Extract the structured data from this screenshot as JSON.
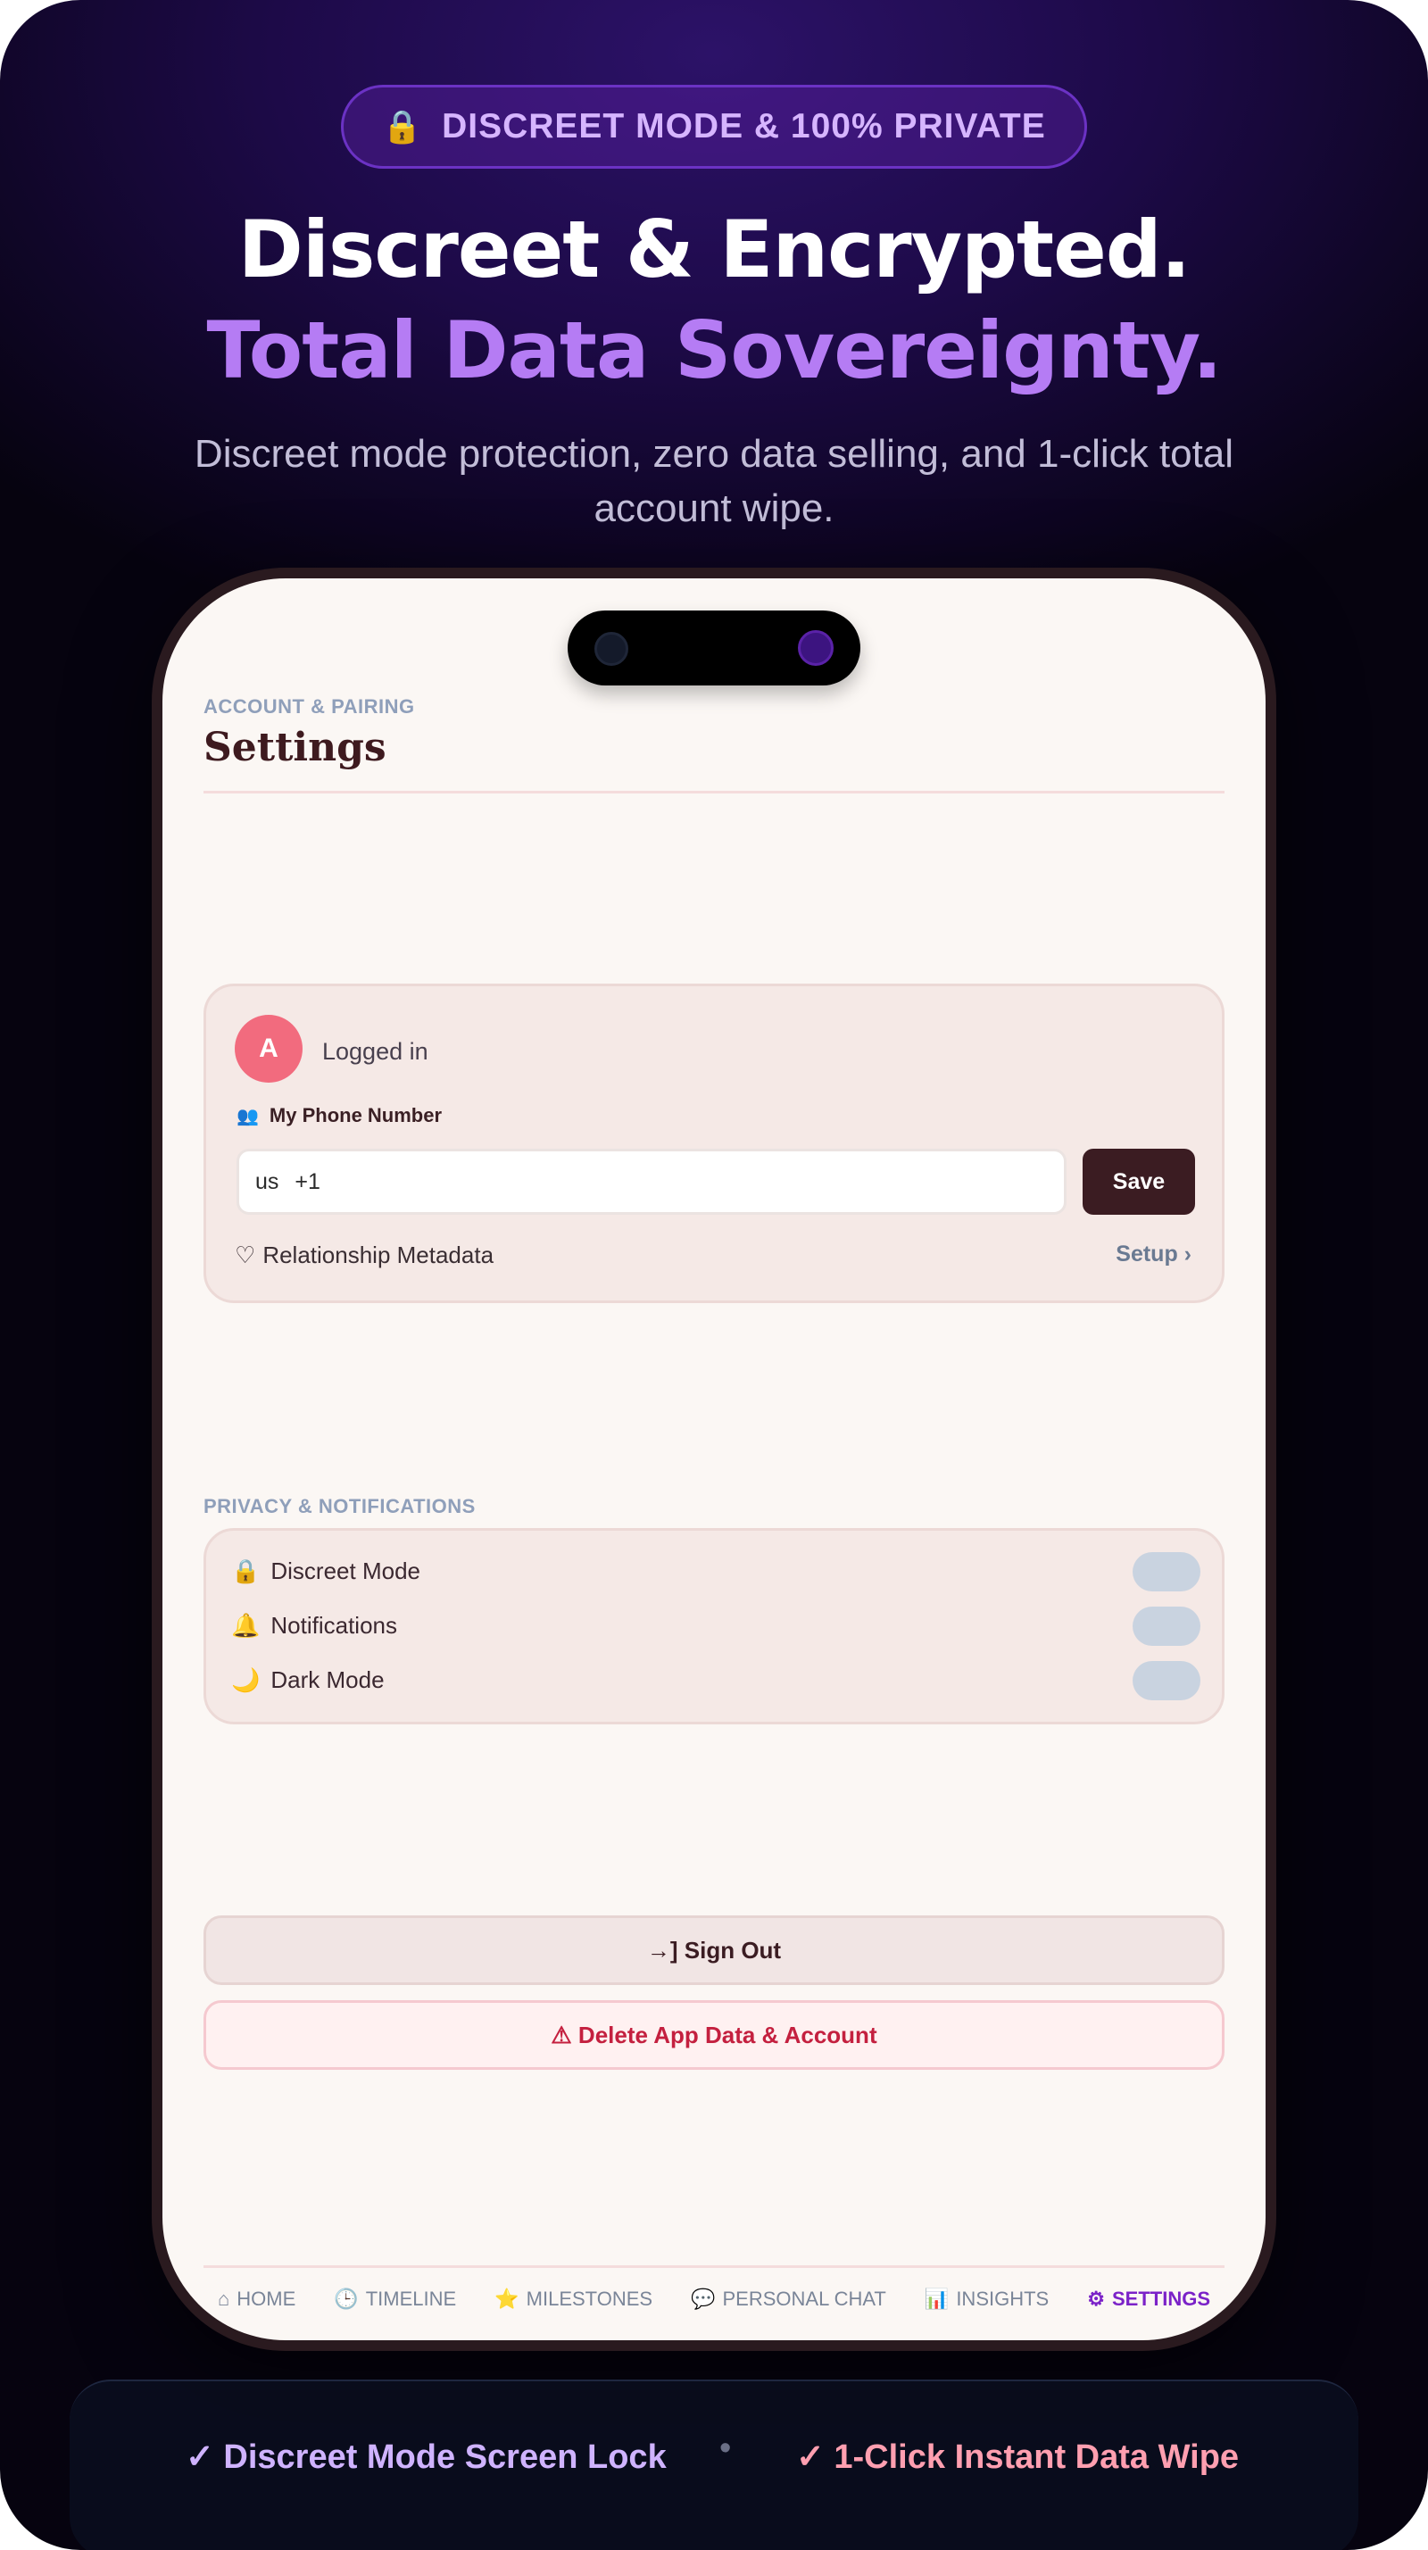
{
  "hero": {
    "badge_icon": "lock-icon",
    "badge_text": "DISCREET MODE & 100% PRIVATE",
    "title_line1": "Discreet & Encrypted.",
    "title_line2": "Total Data Sovereignty.",
    "subtitle": "Discreet mode protection, zero data selling, and 1-click total account wipe."
  },
  "app": {
    "section_label": "ACCOUNT & PAIRING",
    "title": "Settings",
    "account": {
      "avatar_initial": "A",
      "status": "Logged in",
      "phone_label_icon": "people-icon",
      "phone_label": "My Phone Number",
      "country_code": "us",
      "dial_prefix": "+1",
      "save_label": "Save",
      "metadata_icon": "heart-outline-icon",
      "metadata_label": "Relationship Metadata",
      "setup_label": "Setup ›"
    },
    "privacy": {
      "section_label": "PRIVACY & NOTIFICATIONS",
      "items": [
        {
          "icon": "lock-icon",
          "label": "Discreet Mode",
          "enabled": false
        },
        {
          "icon": "bell-icon",
          "label": "Notifications",
          "enabled": false
        },
        {
          "icon": "moon-icon",
          "label": "Dark Mode",
          "enabled": false
        }
      ]
    },
    "actions": {
      "sign_out_label": "→] Sign Out",
      "delete_label": "⚠ Delete App Data & Account"
    },
    "nav": [
      {
        "icon": "home-icon",
        "label": "HOME"
      },
      {
        "icon": "clock-icon",
        "label": "TIMELINE"
      },
      {
        "icon": "star-icon",
        "label": "MILESTONES"
      },
      {
        "icon": "chat-bubble-icon",
        "label": "PERSONAL CHAT"
      },
      {
        "icon": "bar-chart-icon",
        "label": "INSIGHTS"
      },
      {
        "icon": "gear-icon",
        "label": "SETTINGS",
        "active": true
      }
    ]
  },
  "features": {
    "item1": "✓ Discreet Mode Screen Lock",
    "separator": "•",
    "item2": "✓ 1-Click Instant Data Wipe"
  },
  "colors": {
    "accent_purple": "#b57cf4",
    "danger": "#c4203f",
    "avatar": "#f26b7e"
  }
}
